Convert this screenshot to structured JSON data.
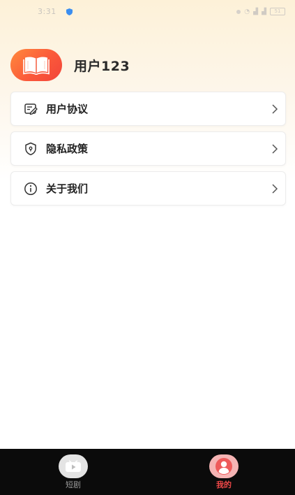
{
  "status_bar": {
    "time": "3:31",
    "battery": "51"
  },
  "profile": {
    "avatar_icon": "open-book-icon",
    "username": "用户123"
  },
  "menu": {
    "items": [
      {
        "label": "用户协议",
        "icon": "document-edit-icon"
      },
      {
        "label": "隐私政策",
        "icon": "shield-icon"
      },
      {
        "label": "关于我们",
        "icon": "info-icon"
      }
    ]
  },
  "bottom_nav": {
    "items": [
      {
        "label": "短剧",
        "icon": "video-play-icon",
        "active": false
      },
      {
        "label": "我的",
        "icon": "user-icon",
        "active": true
      }
    ],
    "active_color": "#f04848",
    "inactive_color": "#9a9a9a"
  },
  "colors": {
    "accent_gradient_start": "#ff8a3d",
    "accent_gradient_end": "#f2443a",
    "header_gradient": "#fdf1d8"
  }
}
